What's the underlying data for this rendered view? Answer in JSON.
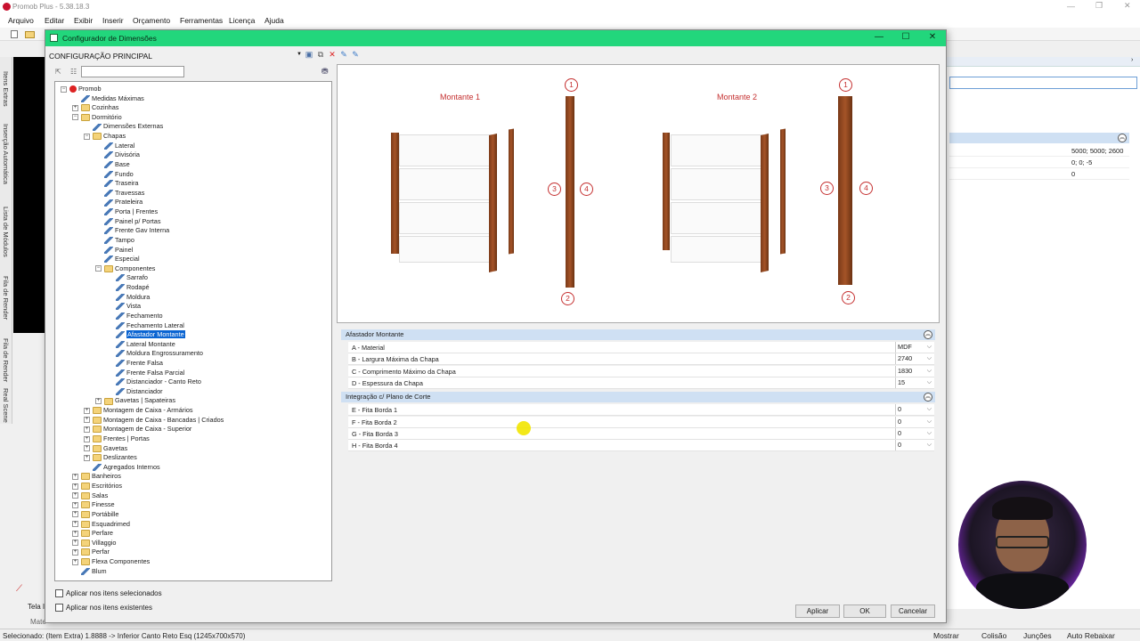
{
  "app": {
    "title": "Promob Plus - 5.38.18.3",
    "menu": [
      "Arquivo",
      "Editar",
      "Exibir",
      "Inserir",
      "Orçamento",
      "Ferramentas",
      "Licença",
      "Ajuda"
    ],
    "side_tabs": [
      "Itens Extras",
      "Inserção Automática",
      "Lista de Módulos",
      "Fila de Render",
      "Fila de Render",
      "Real Scene"
    ],
    "right_values": [
      "5000; 5000; 2600",
      "0; 0; -5",
      "0"
    ],
    "status": "Selecionado: (Item Extra) 1.8888 -> Inferior Canto Reto Esq (1245x700x570)",
    "status_right": [
      "Mostrar",
      "Colisão",
      "Junções",
      "Auto Rebaixar"
    ],
    "bottom_tabs": [
      "Tela I",
      "Mate"
    ]
  },
  "dialog": {
    "title": "Configurador de Dimensões",
    "config_label": "CONFIGURAÇÃO PRINCIPAL",
    "search_value": "",
    "checkbox_selected": "Aplicar nos itens selecionados",
    "checkbox_existing": "Aplicar nos itens existentes",
    "btn_apply": "Aplicar",
    "btn_ok": "OK",
    "btn_cancel": "Cancelar"
  },
  "tree": [
    {
      "l": "Promob",
      "d": 0,
      "i": "root",
      "e": "−"
    },
    {
      "l": "Medidas Máximas",
      "d": 1,
      "i": "pencil"
    },
    {
      "l": "Cozinhas",
      "d": 1,
      "i": "folder",
      "e": "+"
    },
    {
      "l": "Dormitório",
      "d": 1,
      "i": "folder",
      "e": "−"
    },
    {
      "l": "Dimensões Externas",
      "d": 2,
      "i": "pencil"
    },
    {
      "l": "Chapas",
      "d": 2,
      "i": "folder",
      "e": "−"
    },
    {
      "l": "Lateral",
      "d": 3,
      "i": "pencil"
    },
    {
      "l": "Divisória",
      "d": 3,
      "i": "pencil"
    },
    {
      "l": "Base",
      "d": 3,
      "i": "pencil"
    },
    {
      "l": "Fundo",
      "d": 3,
      "i": "pencil"
    },
    {
      "l": "Traseira",
      "d": 3,
      "i": "pencil"
    },
    {
      "l": "Travessas",
      "d": 3,
      "i": "pencil"
    },
    {
      "l": "Prateleira",
      "d": 3,
      "i": "pencil"
    },
    {
      "l": "Porta | Frentes",
      "d": 3,
      "i": "pencil"
    },
    {
      "l": "Painel p/ Portas",
      "d": 3,
      "i": "pencil"
    },
    {
      "l": "Frente Gav Interna",
      "d": 3,
      "i": "pencil"
    },
    {
      "l": "Tampo",
      "d": 3,
      "i": "pencil"
    },
    {
      "l": "Painel",
      "d": 3,
      "i": "pencil"
    },
    {
      "l": "Especial",
      "d": 3,
      "i": "pencil"
    },
    {
      "l": "Componentes",
      "d": 3,
      "i": "folder",
      "e": "−"
    },
    {
      "l": "Sarrafo",
      "d": 4,
      "i": "pencil"
    },
    {
      "l": "Rodapé",
      "d": 4,
      "i": "pencil"
    },
    {
      "l": "Moldura",
      "d": 4,
      "i": "pencil"
    },
    {
      "l": "Vista",
      "d": 4,
      "i": "pencil"
    },
    {
      "l": "Fechamento",
      "d": 4,
      "i": "pencil"
    },
    {
      "l": "Fechamento Lateral",
      "d": 4,
      "i": "pencil"
    },
    {
      "l": "Afastador Montante",
      "d": 4,
      "i": "pencil",
      "sel": true
    },
    {
      "l": "Lateral Montante",
      "d": 4,
      "i": "pencil"
    },
    {
      "l": "Moldura Engrossuramento",
      "d": 4,
      "i": "pencil"
    },
    {
      "l": "Frente Falsa",
      "d": 4,
      "i": "pencil"
    },
    {
      "l": "Frente Falsa Parcial",
      "d": 4,
      "i": "pencil"
    },
    {
      "l": "Distanciador - Canto Reto",
      "d": 4,
      "i": "pencil"
    },
    {
      "l": "Distanciador",
      "d": 4,
      "i": "pencil"
    },
    {
      "l": "Gavetas | Sapateiras",
      "d": 3,
      "i": "folder",
      "e": "+"
    },
    {
      "l": "Montagem de Caixa - Armários",
      "d": 2,
      "i": "folder",
      "e": "+"
    },
    {
      "l": "Montagem de Caixa - Bancadas | Criados",
      "d": 2,
      "i": "folder",
      "e": "+"
    },
    {
      "l": "Montagem de Caixa - Superior",
      "d": 2,
      "i": "folder",
      "e": "+"
    },
    {
      "l": "Frentes | Portas",
      "d": 2,
      "i": "folder",
      "e": "+"
    },
    {
      "l": "Gavetas",
      "d": 2,
      "i": "folder",
      "e": "+"
    },
    {
      "l": "Deslizantes",
      "d": 2,
      "i": "folder",
      "e": "+"
    },
    {
      "l": "Agregados Internos",
      "d": 2,
      "i": "pencil"
    },
    {
      "l": "Banheiros",
      "d": 1,
      "i": "folder",
      "e": "+"
    },
    {
      "l": "Escritórios",
      "d": 1,
      "i": "folder",
      "e": "+"
    },
    {
      "l": "Salas",
      "d": 1,
      "i": "folder",
      "e": "+"
    },
    {
      "l": "Finesse",
      "d": 1,
      "i": "folder",
      "e": "+"
    },
    {
      "l": "Portábille",
      "d": 1,
      "i": "folder",
      "e": "+"
    },
    {
      "l": "Esquadrimed",
      "d": 1,
      "i": "folder",
      "e": "+"
    },
    {
      "l": "Perfare",
      "d": 1,
      "i": "folder",
      "e": "+"
    },
    {
      "l": "Villaggio",
      "d": 1,
      "i": "folder",
      "e": "+"
    },
    {
      "l": "Perfar",
      "d": 1,
      "i": "folder",
      "e": "+"
    },
    {
      "l": "Flexa Componentes",
      "d": 1,
      "i": "folder",
      "e": "+"
    },
    {
      "l": "Blum",
      "d": 1,
      "i": "pencil"
    }
  ],
  "preview": {
    "label1": "Montante 1",
    "label2": "Montante 2",
    "n1": "1",
    "n2": "2",
    "n3": "3",
    "n4": "4"
  },
  "sections": [
    {
      "title": "Afastador Montante",
      "rows": [
        {
          "label": "A - Material",
          "value": "MDF"
        },
        {
          "label": "B - Largura Máxima da Chapa",
          "value": "2740"
        },
        {
          "label": "C - Comprimento Máximo da Chapa",
          "value": "1830"
        },
        {
          "label": "D - Espessura da Chapa",
          "value": "15"
        }
      ]
    },
    {
      "title": "Integração c/ Plano de Corte",
      "rows": [
        {
          "label": "E - Fita Borda 1",
          "value": "0"
        },
        {
          "label": "F - Fita Borda 2",
          "value": "0"
        },
        {
          "label": "G - Fita Borda 3",
          "value": "0"
        },
        {
          "label": "H - Fita Borda 4",
          "value": "0"
        }
      ]
    }
  ]
}
